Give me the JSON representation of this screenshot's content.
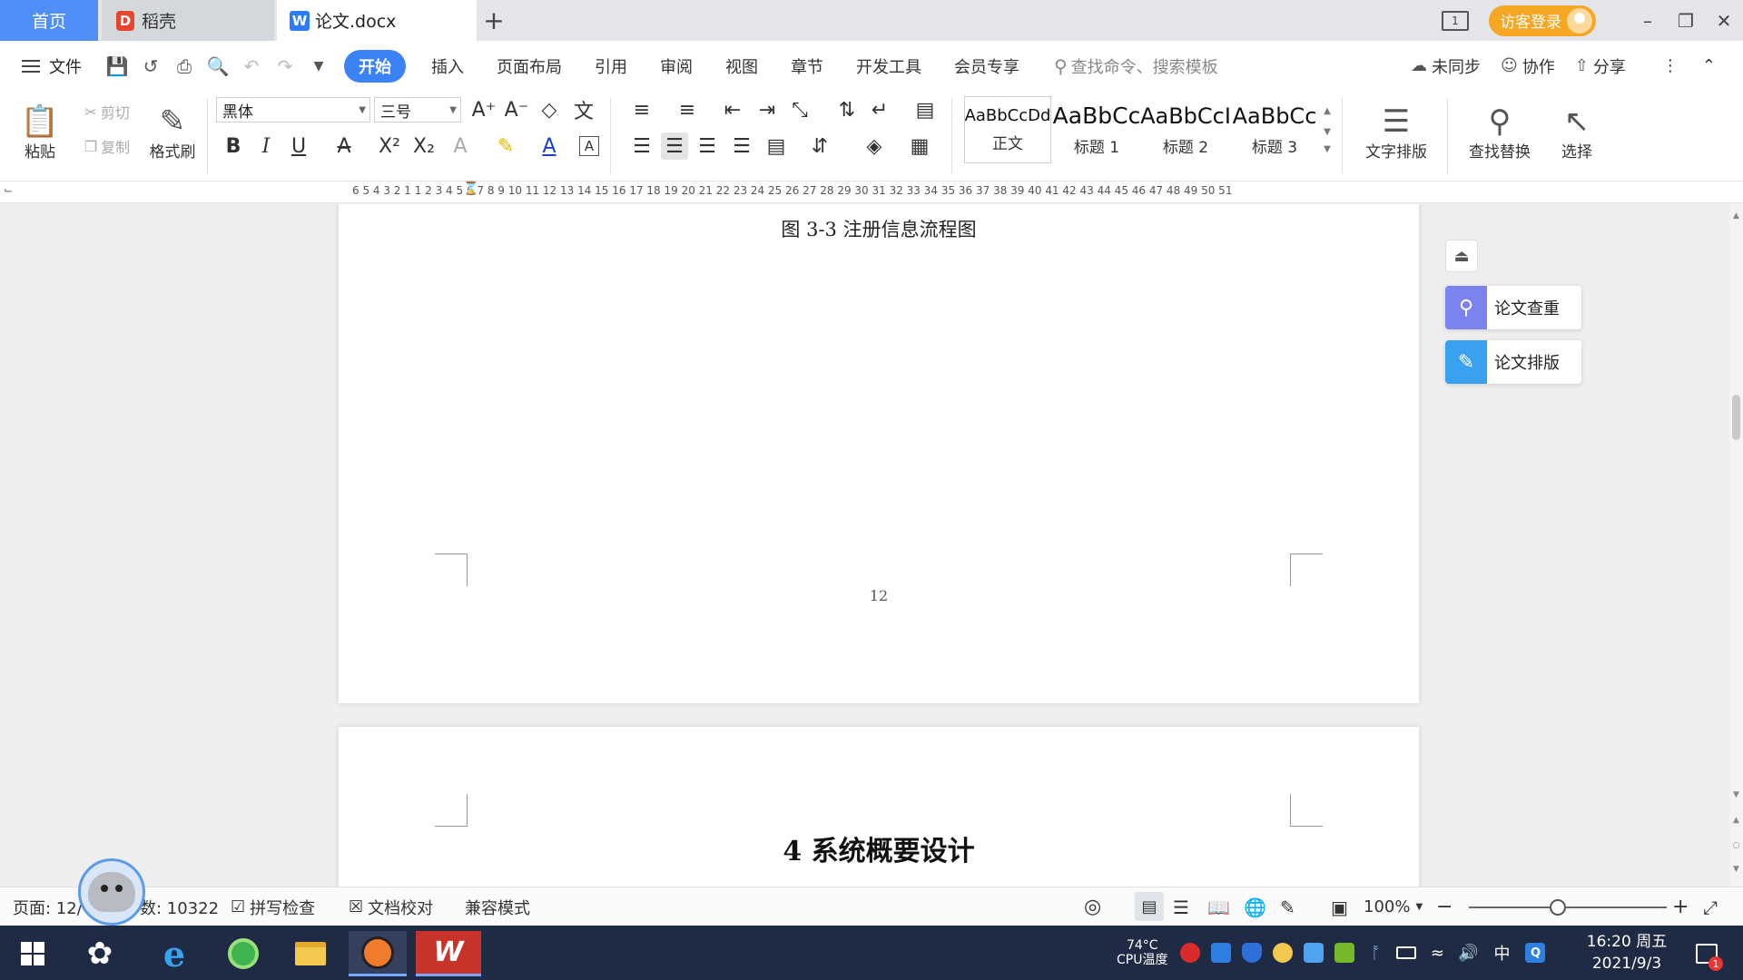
{
  "tabs": {
    "home": "首页",
    "docer": "稻壳",
    "document": "论文.docx",
    "add": "+"
  },
  "titlebar": {
    "window_badge": "1",
    "visitor_login": "访客登录"
  },
  "menu": {
    "file": "文件",
    "tabs": [
      "开始",
      "插入",
      "页面布局",
      "引用",
      "审阅",
      "视图",
      "章节",
      "开发工具",
      "会员专享"
    ],
    "search_placeholder": "查找命令、搜索模板",
    "sync": "未同步",
    "collab": "协作",
    "share": "分享"
  },
  "ribbon": {
    "paste": "粘贴",
    "cut": "剪切",
    "copy": "复制",
    "format_painter": "格式刷",
    "font_name": "黑体",
    "font_size": "三号",
    "styles": [
      {
        "sample": "AaBbCcDd",
        "name": "正文"
      },
      {
        "sample": "AaBbCc",
        "name": "标题 1"
      },
      {
        "sample": "AaBbCcI",
        "name": "标题 2"
      },
      {
        "sample": "AaBbCc",
        "name": "标题 3"
      }
    ],
    "text_layout": "文字排版",
    "find_replace": "查找替换",
    "select": "选择"
  },
  "ruler": {
    "scale": "6  5  4  3  2  1      1  2  3  4  5  6  7  8  9 10 11 12 13 14 15 16 17 18 19 20 21 22 23 24 25 26 27 28 29 30 31 32 33 34 35 36 37 38 39 40 41 42 43 44 45 46 47 48 49 50 51"
  },
  "document": {
    "figure_caption": "图 3-3 注册信息流程图",
    "page_number": "12",
    "next_heading": "4 系统概要设计"
  },
  "side_panel": {
    "check": "论文查重",
    "layout": "论文排版"
  },
  "statusbar": {
    "page": "页面: 12/",
    "words": "数: 10322",
    "spell_check": "拼写检查",
    "proofread": "文档校对",
    "compat_mode": "兼容模式",
    "zoom": "100%"
  },
  "taskbar": {
    "cpu_temp": "74°C",
    "cpu_label": "CPU温度",
    "ime": "中",
    "time": "16:20 周五",
    "date": "2021/9/3",
    "notification_count": "1"
  },
  "colors": {
    "accent": "#3b82f6",
    "home_tab": "#4f8ff7",
    "visitor": "#f5a623",
    "taskbar": "#1f2a44"
  }
}
